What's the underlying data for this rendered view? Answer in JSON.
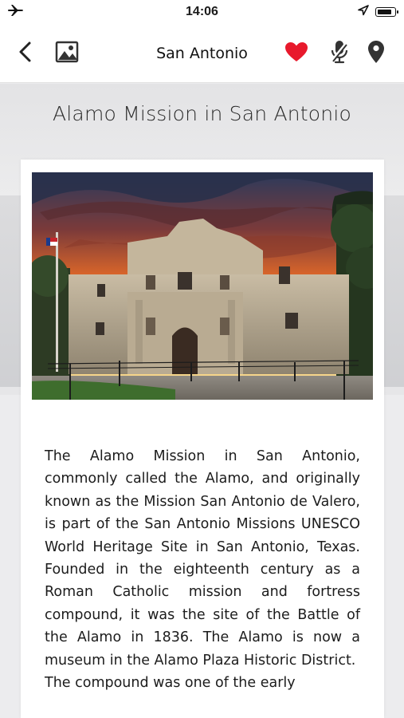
{
  "status_bar": {
    "time": "14:06",
    "left_icon": "airplane-icon",
    "right_icons": [
      "location-arrow-icon",
      "battery-icon"
    ],
    "battery_level": 0.9
  },
  "nav": {
    "title": "San Antonio",
    "back_icon": "chevron-left-icon",
    "gallery_icon": "image-icon",
    "favorite_icon": "heart-icon",
    "audio_icon": "microphone-icon",
    "location_icon": "map-pin-icon",
    "favorite_color": "#e8192c",
    "icon_color": "#222222"
  },
  "page": {
    "title": "Alamo Mission in San Antonio",
    "photo_subject": "alamo-mission-photo"
  },
  "description": {
    "paragraphs": [
      "The Alamo Mission in San Antonio, commonly called the Alamo, and originally known as the Mission San Antonio de Valero, is part of the San Antonio Missions UNESCO World Heritage Site in San Antonio, Texas. Founded in the eighteenth century as a Roman Catholic mission and fortress compound, it was the site of the Battle of the Alamo in 1836. The Alamo is now a museum in the Alamo Plaza Historic District.",
      "The compound was one of the early"
    ]
  }
}
